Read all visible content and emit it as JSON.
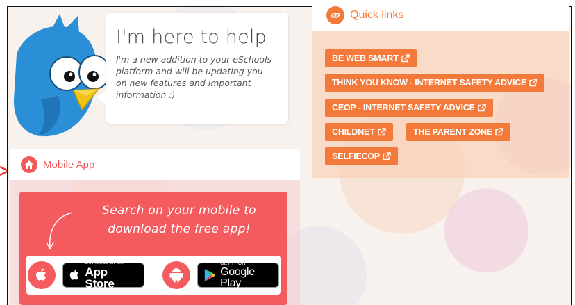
{
  "mascot": {
    "title": "I'm here to help",
    "body": "I'm a new addition to your eSchools platform and will be updating you on new features and important information :)"
  },
  "mobile_app": {
    "header": "Mobile App",
    "promo_text": "Search on your mobile to download the free app!",
    "app_store": {
      "small": "Download on the",
      "big": "App Store"
    },
    "google_play": {
      "small": "GET IT ON",
      "big": "Google Play"
    }
  },
  "quick_links": {
    "header": "Quick links",
    "links": [
      "BE WEB SMART",
      "THINK YOU KNOW - INTERNET SAFETY ADVICE",
      "CEOP - INTERNET SAFETY ADVICE",
      "CHILDNET",
      "THE PARENT ZONE",
      "SELFIECOP"
    ]
  },
  "colors": {
    "mobile_accent": "#ef5a5a",
    "quick_links_accent": "#f37a3a"
  },
  "icons": [
    "home-icon",
    "link-icon",
    "apple-icon",
    "android-icon",
    "google-play-icon",
    "external-link-icon"
  ]
}
